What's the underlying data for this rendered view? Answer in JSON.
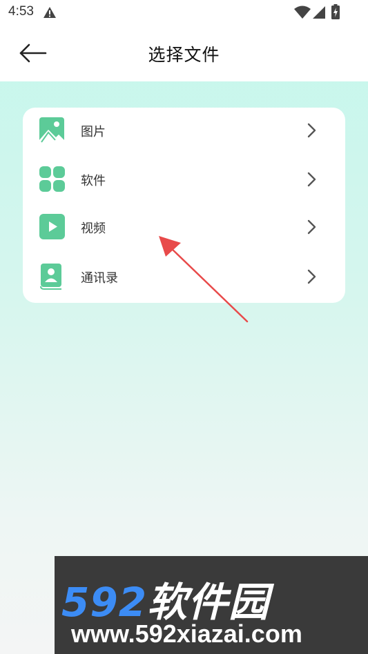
{
  "status_bar": {
    "time": "4:53"
  },
  "header": {
    "title": "选择文件"
  },
  "file_types": [
    {
      "label": "图片"
    },
    {
      "label": "软件"
    },
    {
      "label": "视频"
    },
    {
      "label": "通讯录"
    }
  ],
  "watermark": {
    "brand_number": "592",
    "brand_text": "软件园",
    "url": "www.592xiazai.com"
  },
  "colors": {
    "accent_green": "#5ccb98",
    "annotation_red": "#e84a4a",
    "bg_top": "#c4f7ec"
  },
  "icons": [
    "warning-icon",
    "wifi-icon",
    "signal-icon",
    "battery-icon",
    "back-arrow-icon",
    "image-icon",
    "apps-icon",
    "video-icon",
    "contacts-icon",
    "chevron-right-icon"
  ]
}
